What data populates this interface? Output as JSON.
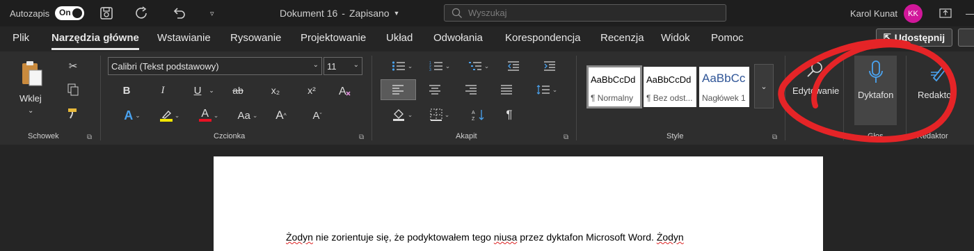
{
  "titlebar": {
    "autosave_label": "Autozapis",
    "toggle_state": "On",
    "doc_title": "Dokument 16",
    "saved_status": "Zapisano",
    "search_placeholder": "Wyszukaj",
    "user_name": "Karol Kunat",
    "user_initials": "KK",
    "icons": [
      "save-icon",
      "redo-icon",
      "undo-icon",
      "customize-icon",
      "search-icon",
      "ribbon-display-icon",
      "minimize-icon",
      "maximize-icon",
      "close-icon"
    ]
  },
  "tabs": [
    "Plik",
    "Narzędzia główne",
    "Wstawianie",
    "Rysowanie",
    "Projektowanie",
    "Układ",
    "Odwołania",
    "Korespondencja",
    "Recenzja",
    "Widok",
    "Pomoc"
  ],
  "active_tab": "Narzędzia główne",
  "share_label": "Udostępnij",
  "ribbon": {
    "clipboard": {
      "paste_label": "Wklej",
      "group_label": "Schowek"
    },
    "font": {
      "font_name": "Calibri (Tekst podstawowy)",
      "font_size": "11",
      "group_label": "Czcionka",
      "bold": "B",
      "italic": "I",
      "underline": "U",
      "strike": "ab",
      "subscript": "x₂",
      "superscript": "x²",
      "case": "Aa",
      "grow": "A^",
      "shrink": "Aˇ"
    },
    "paragraph": {
      "group_label": "Akapit",
      "pilcrow": "¶"
    },
    "styles": {
      "group_label": "Style",
      "items": [
        {
          "sample": "AaBbCcDd",
          "name": "¶ Normalny"
        },
        {
          "sample": "AaBbCcDd",
          "name": "¶ Bez odst..."
        },
        {
          "sample": "AaBbCc",
          "name": "Nagłówek 1"
        }
      ]
    },
    "editing": {
      "label": "Edytowanie"
    },
    "voice": {
      "label": "Dyktafon",
      "group_label": "Głos"
    },
    "editor": {
      "label": "Redaktor",
      "group_label": "Redaktor"
    },
    "accent_colors": {
      "highlight": "#f2e600",
      "font_color": "#e81123",
      "text_effects": "#4aa3f0",
      "annotation": "#e52427"
    }
  },
  "document": {
    "text_before": " nie zorientuje się, że podyktowałem tego ",
    "word1": "Żodyn",
    "word2": "niusa",
    "text_after": " przez dyktafon Microsoft Word. ",
    "word3": "Żodyn"
  }
}
